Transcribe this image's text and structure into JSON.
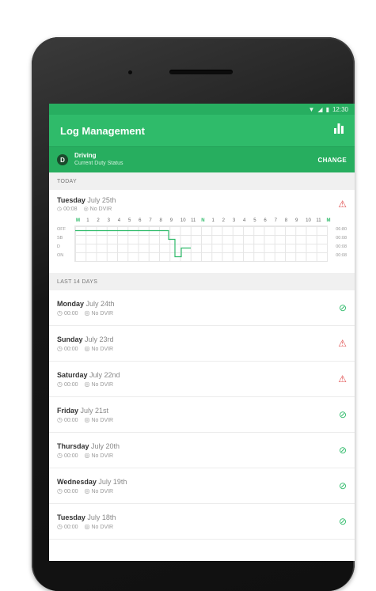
{
  "status_bar": {
    "time": "12:30"
  },
  "appbar": {
    "title": "Log Management",
    "chart_icon": "bar-chart-icon"
  },
  "duty": {
    "badge": "D",
    "status": "Driving",
    "subtitle": "Current Duty Status",
    "change_label": "CHANGE"
  },
  "today": {
    "section_label": "TODAY",
    "day": "Tuesday",
    "date": "July 25th",
    "time": "00:08",
    "dvir": "No DVIR",
    "status": "warning",
    "hour_labels": [
      "M",
      "1",
      "2",
      "3",
      "4",
      "5",
      "6",
      "7",
      "8",
      "9",
      "10",
      "11",
      "N",
      "1",
      "2",
      "3",
      "4",
      "5",
      "6",
      "7",
      "8",
      "9",
      "10",
      "11",
      "M"
    ],
    "grid_rows": [
      "OFF",
      "SB",
      "D",
      "ON"
    ],
    "grid_totals": [
      "06:80",
      "00:08",
      "00:08",
      "00:08"
    ]
  },
  "history": {
    "section_label": "LAST 14 DAYS",
    "items": [
      {
        "day": "Monday",
        "date": "July 24th",
        "time": "00:00",
        "dvir": "No DVIR",
        "status": "ok"
      },
      {
        "day": "Sunday",
        "date": "July 23rd",
        "time": "00:00",
        "dvir": "No DVIR",
        "status": "warning"
      },
      {
        "day": "Saturday",
        "date": "July 22nd",
        "time": "00:00",
        "dvir": "No DVIR",
        "status": "warning"
      },
      {
        "day": "Friday",
        "date": "July 21st",
        "time": "00:00",
        "dvir": "No DVIR",
        "status": "ok"
      },
      {
        "day": "Thursday",
        "date": "July 20th",
        "time": "00:00",
        "dvir": "No DVIR",
        "status": "ok"
      },
      {
        "day": "Wednesday",
        "date": "July 19th",
        "time": "00:00",
        "dvir": "No DVIR",
        "status": "ok"
      },
      {
        "day": "Tuesday",
        "date": "July 18th",
        "time": "00:00",
        "dvir": "No DVIR",
        "status": "ok"
      }
    ]
  },
  "colors": {
    "primary": "#2fbb6a",
    "primary_dark": "#27ae60",
    "warning": "#e04b4b"
  }
}
